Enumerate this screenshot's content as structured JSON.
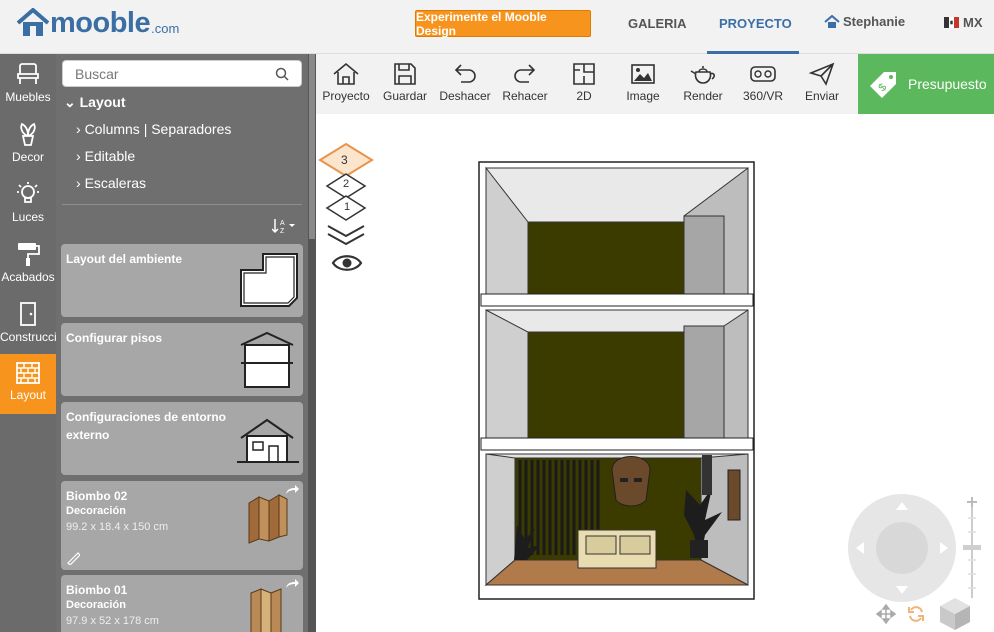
{
  "header": {
    "logo_text": "mooble",
    "logo_suffix": ".com",
    "design_button": "Experimente el Mooble Design",
    "nav": [
      "GALERIA",
      "PROYECTO"
    ],
    "active_nav": "PROYECTO",
    "user_name": "Stephanie",
    "country": "MX",
    "accent_color": "#3a6ea5",
    "orange_color": "#f7941d"
  },
  "sidebar_icons": [
    {
      "label": "Muebles",
      "icon": "chair-icon"
    },
    {
      "label": "Decor",
      "icon": "plant-icon"
    },
    {
      "label": "Luces",
      "icon": "bulb-icon"
    },
    {
      "label": "Acabados",
      "icon": "paint-roller-icon"
    },
    {
      "label": "Construcción",
      "icon": "door-icon"
    },
    {
      "label": "Layout",
      "icon": "brick-wall-icon",
      "active": true
    }
  ],
  "panel": {
    "search_placeholder": "Buscar",
    "tree_title": "Layout",
    "tree_items": [
      "Columns | Separadores",
      "Editable",
      "Escaleras"
    ],
    "cards": [
      {
        "title": "Layout del ambiente",
        "icon": "room-shape-icon"
      },
      {
        "title": "Configurar pisos",
        "icon": "floors-icon"
      },
      {
        "title": "Configuraciones de entorno externo",
        "icon": "house-icon"
      },
      {
        "title": "Biombo 02",
        "subtitle": "Decoración",
        "dims": "99.2 x 18.4 x 150 cm"
      },
      {
        "title": "Biombo 01",
        "subtitle": "Decoración",
        "dims": "97.9 x 52 x 178 cm"
      }
    ]
  },
  "toolbar": {
    "tools": [
      {
        "label": "Proyecto",
        "icon": "home-icon"
      },
      {
        "label": "Guardar",
        "icon": "save-icon"
      },
      {
        "label": "Deshacer",
        "icon": "undo-icon"
      },
      {
        "label": "Rehacer",
        "icon": "redo-icon"
      },
      {
        "label": "2D",
        "icon": "floorplan-icon"
      },
      {
        "label": "Image",
        "icon": "image-icon"
      },
      {
        "label": "Render",
        "icon": "teapot-icon"
      },
      {
        "label": "360/VR",
        "icon": "vr-icon"
      },
      {
        "label": "Enviar",
        "icon": "send-icon"
      }
    ],
    "budget_label": "Presupuesto",
    "budget_color": "#5cb85c"
  },
  "floors": [
    "3",
    "2",
    "1"
  ],
  "active_floor": "3"
}
